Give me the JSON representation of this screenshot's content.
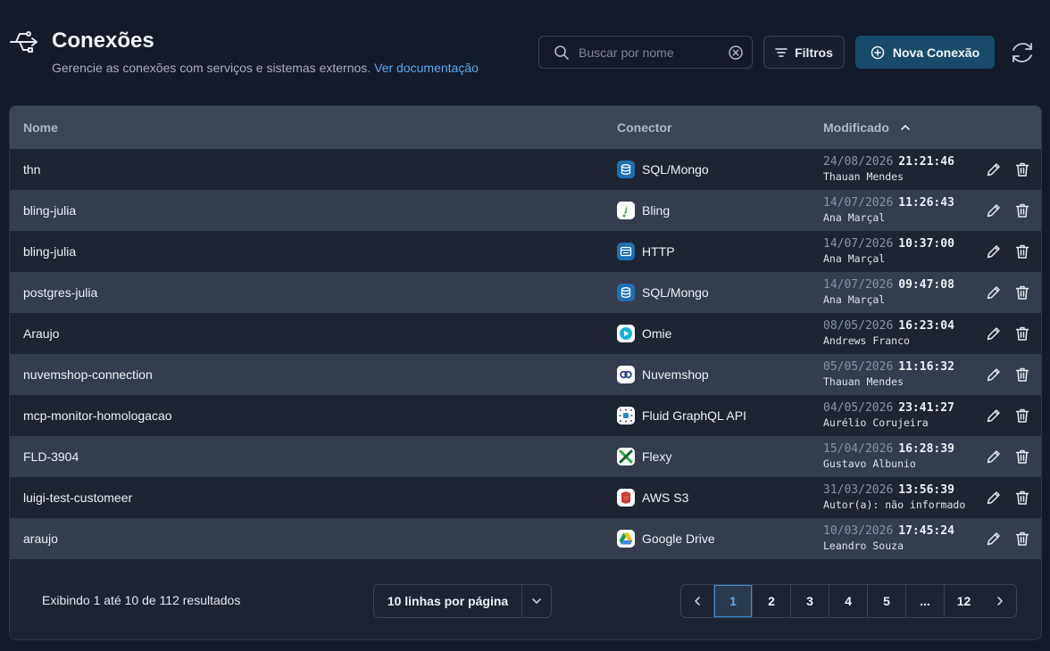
{
  "header": {
    "title": "Conexões",
    "subtitle": "Gerencie as conexões com serviços e sistemas externos.",
    "doc_link": "Ver documentação",
    "icon": "usb-connection-icon"
  },
  "search": {
    "placeholder": "Buscar por nome",
    "value": ""
  },
  "toolbar": {
    "filter_label": "Filtros",
    "new_label": "Nova Conexão",
    "refresh_icon": "refresh-icon"
  },
  "table": {
    "columns": {
      "name": "Nome",
      "connector": "Conector",
      "modified": "Modificado"
    },
    "sort": "ascending",
    "rows": [
      {
        "name": "thn",
        "connector": "SQL/Mongo",
        "connector_icon": "database-icon",
        "date": "24/08/2026",
        "time": "21:21:46",
        "user": "Thauan Mendes"
      },
      {
        "name": "bling-julia",
        "connector": "Bling",
        "connector_icon": "bling-icon",
        "date": "14/07/2026",
        "time": "11:26:43",
        "user": "Ana Marçal"
      },
      {
        "name": "bling-julia",
        "connector": "HTTP",
        "connector_icon": "http-icon",
        "date": "14/07/2026",
        "time": "10:37:00",
        "user": "Ana Marçal"
      },
      {
        "name": "postgres-julia",
        "connector": "SQL/Mongo",
        "connector_icon": "database-icon",
        "date": "14/07/2026",
        "time": "09:47:08",
        "user": "Ana Marçal"
      },
      {
        "name": "Araujo",
        "connector": "Omie",
        "connector_icon": "omie-icon",
        "date": "08/05/2026",
        "time": "16:23:04",
        "user": "Andrews Franco"
      },
      {
        "name": "nuvemshop-connection",
        "connector": "Nuvemshop",
        "connector_icon": "nuvemshop-icon",
        "date": "05/05/2026",
        "time": "11:16:32",
        "user": "Thauan Mendes"
      },
      {
        "name": "mcp-monitor-homologacao",
        "connector": "Fluid GraphQL API",
        "connector_icon": "graphql-icon",
        "date": "04/05/2026",
        "time": "23:41:27",
        "user": "Aurélio Corujeira"
      },
      {
        "name": "FLD-3904",
        "connector": "Flexy",
        "connector_icon": "flexy-icon",
        "date": "15/04/2026",
        "time": "16:28:39",
        "user": "Gustavo Albunio"
      },
      {
        "name": "luigi-test-customeer",
        "connector": "AWS S3",
        "connector_icon": "aws-s3-icon",
        "date": "31/03/2026",
        "time": "13:56:39",
        "user": "Autor(a): não informado"
      },
      {
        "name": "araujo",
        "connector": "Google Drive",
        "connector_icon": "google-drive-icon",
        "date": "10/03/2026",
        "time": "17:45:24",
        "user": "Leandro Souza"
      }
    ]
  },
  "footer": {
    "info": "Exibindo 1 até 10 de 112 resultados",
    "rows_per_page": "10 linhas por página",
    "pages": [
      "1",
      "2",
      "3",
      "4",
      "5",
      "...",
      "12"
    ],
    "current_page": "1"
  },
  "colors": {
    "accent": "#174b69",
    "link": "#5aa9f0",
    "active_page": "#59aff2"
  }
}
